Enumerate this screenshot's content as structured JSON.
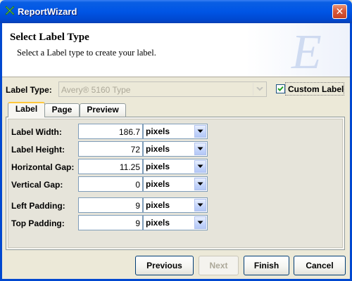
{
  "window": {
    "title": "ReportWizard",
    "close_label": "✕"
  },
  "header": {
    "title": "Select Label Type",
    "subtitle": "Select a Label type to create your label.",
    "logo_letter": "E"
  },
  "label_type": {
    "label": "Label Type:",
    "selected": "Avery® 5160 Type",
    "enabled": false
  },
  "custom_label": {
    "label": "Custom Label",
    "checked": true
  },
  "tabs": [
    {
      "label": "Label",
      "active": true
    },
    {
      "label": "Page",
      "active": false
    },
    {
      "label": "Preview",
      "active": false
    }
  ],
  "fields": [
    {
      "label": "Label Width:",
      "value": "186.7",
      "unit": "pixels"
    },
    {
      "label": "Label Height:",
      "value": "72",
      "unit": "pixels"
    },
    {
      "label": "Horizontal Gap:",
      "value": "11.25",
      "unit": "pixels"
    },
    {
      "label": "Vertical Gap:",
      "value": "0",
      "unit": "pixels"
    },
    {
      "label": "Left Padding:",
      "value": "9",
      "unit": "pixels"
    },
    {
      "label": "Top Padding:",
      "value": "9",
      "unit": "pixels"
    }
  ],
  "buttons": {
    "previous": "Previous",
    "next": "Next",
    "finish": "Finish",
    "cancel": "Cancel"
  },
  "colors": {
    "titlebar": "#0055e5",
    "tab_accent": "#ffc83c",
    "input_border": "#7f9db9"
  }
}
